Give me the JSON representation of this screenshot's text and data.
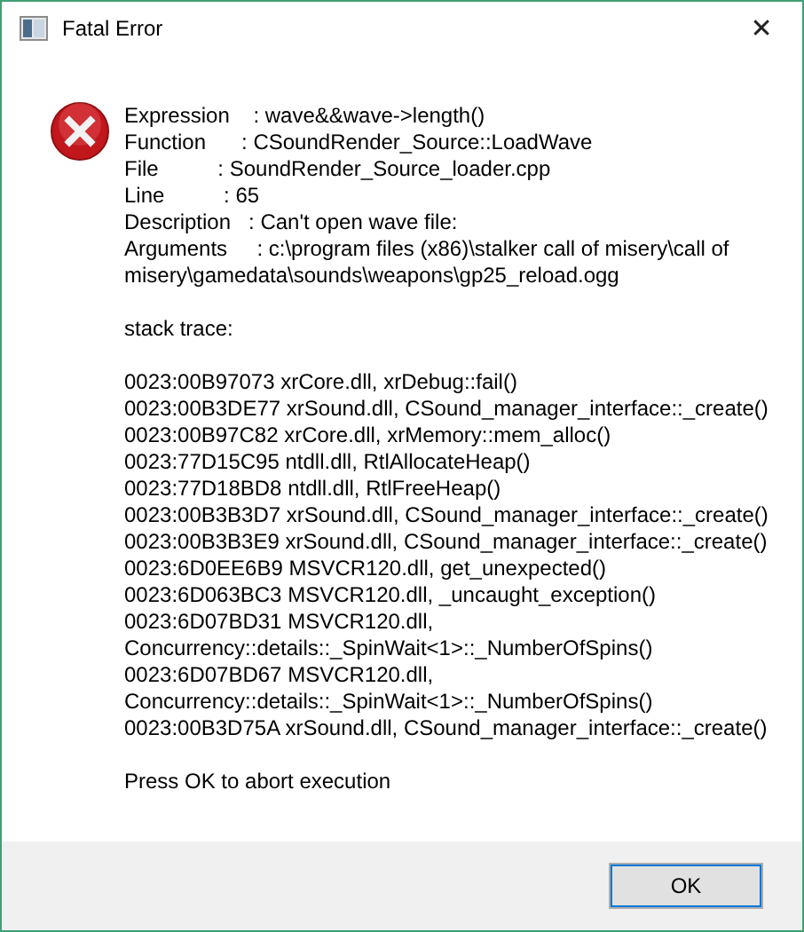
{
  "window": {
    "title": "Fatal Error",
    "close": "✕"
  },
  "details": [
    "Expression    : wave&&wave->length()",
    "Function      : CSoundRender_Source::LoadWave",
    "File          : SoundRender_Source_loader.cpp",
    "Line          : 65",
    "Description   : Can't open wave file:",
    "Arguments     : c:\\program files (x86)\\stalker call of misery\\call of misery\\gamedata\\sounds\\weapons\\gp25_reload.ogg"
  ],
  "stack_title": "stack trace:",
  "stack": [
    "0023:00B97073 xrCore.dll, xrDebug::fail()",
    "0023:00B3DE77 xrSound.dll, CSound_manager_interface::_create()",
    "0023:00B97C82 xrCore.dll, xrMemory::mem_alloc()",
    "0023:77D15C95 ntdll.dll, RtlAllocateHeap()",
    "0023:77D18BD8 ntdll.dll, RtlFreeHeap()",
    "0023:00B3B3D7 xrSound.dll, CSound_manager_interface::_create()",
    "0023:00B3B3E9 xrSound.dll, CSound_manager_interface::_create()",
    "0023:6D0EE6B9 MSVCR120.dll, get_unexpected()",
    "0023:6D063BC3 MSVCR120.dll, _uncaught_exception()",
    "0023:6D07BD31 MSVCR120.dll, Concurrency::details::_SpinWait<1>::_NumberOfSpins()",
    "0023:6D07BD67 MSVCR120.dll, Concurrency::details::_SpinWait<1>::_NumberOfSpins()",
    "0023:00B3D75A xrSound.dll, CSound_manager_interface::_create()"
  ],
  "prompt": "Press OK to abort execution",
  "buttons": [
    "OK"
  ]
}
